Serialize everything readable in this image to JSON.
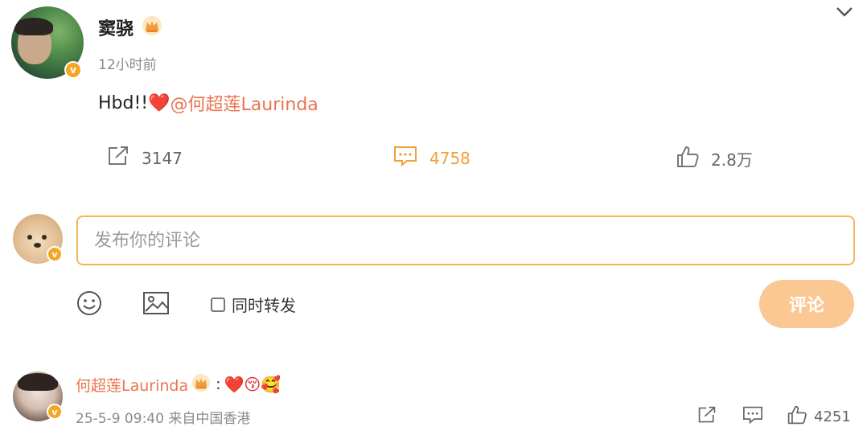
{
  "post": {
    "author": "窦骁",
    "time": "12小时前",
    "text": "Hbd!! ",
    "heart": "❤️",
    "mention": "@何超莲Laurinda",
    "actions": {
      "repost_count": "3147",
      "comment_count": "4758",
      "like_count": "2.8万"
    }
  },
  "composer": {
    "placeholder": "发布你的评论",
    "also_repost_label": "同时转发",
    "submit_label": "评论"
  },
  "reply": {
    "author": "何超莲Laurinda",
    "separator": ":",
    "emojis": "❤️😚🥰",
    "meta": "25-5-9 09:40 来自中国香港",
    "like_count": "4251"
  },
  "colors": {
    "accent": "#f0a03c",
    "mention": "#eb7350",
    "submit_bg": "#fbc893",
    "badge": "#f6a623"
  }
}
